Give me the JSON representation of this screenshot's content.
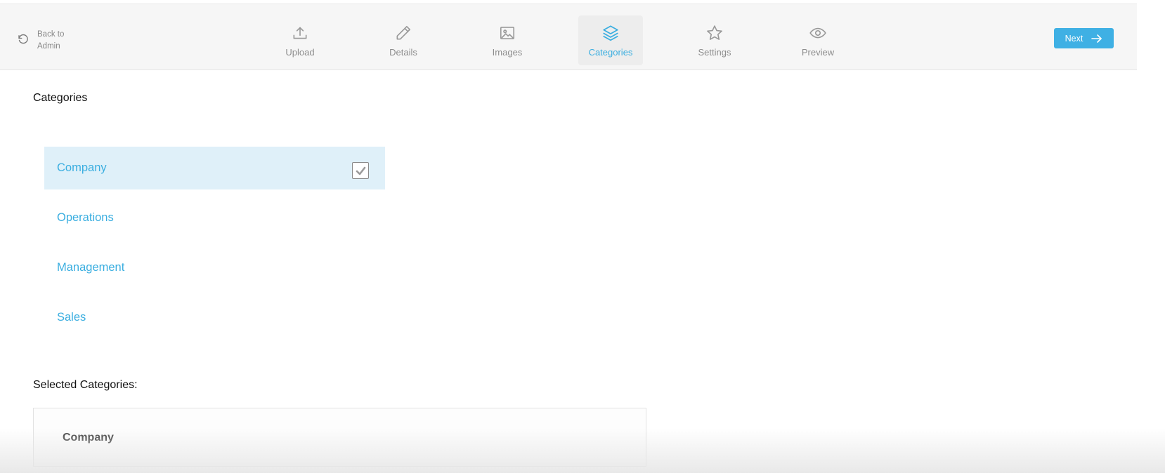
{
  "header": {
    "back_label": "Back to Admin",
    "next_label": "Next",
    "steps": [
      {
        "label": "Upload",
        "icon": "upload-icon"
      },
      {
        "label": "Details",
        "icon": "pencil-icon"
      },
      {
        "label": "Images",
        "icon": "image-icon"
      },
      {
        "label": "Categories",
        "icon": "layers-icon",
        "active": true
      },
      {
        "label": "Settings",
        "icon": "star-icon"
      },
      {
        "label": "Preview",
        "icon": "eye-icon"
      }
    ]
  },
  "categories": {
    "title": "Categories",
    "items": [
      {
        "label": "Company",
        "selected": true
      },
      {
        "label": "Operations",
        "selected": false
      },
      {
        "label": "Management",
        "selected": false
      },
      {
        "label": "Sales",
        "selected": false
      }
    ]
  },
  "selected": {
    "title": "Selected Categories:",
    "items": [
      "Company"
    ]
  },
  "colors": {
    "accent": "#3aaee0",
    "button": "#3fb0e4",
    "selected_bg": "#dff0f9",
    "topbar_bg": "#f6f6f6"
  }
}
